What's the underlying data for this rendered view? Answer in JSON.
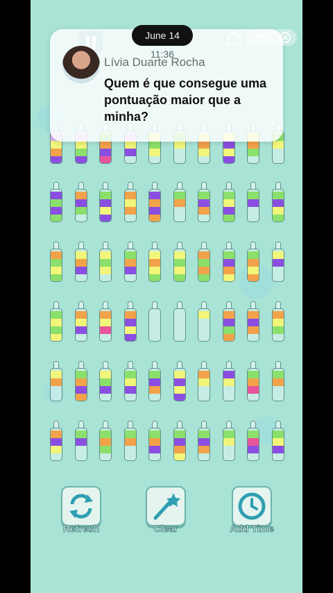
{
  "status": {
    "date": "June 14",
    "time": "11:36"
  },
  "notification": {
    "sender": "Lívia Duarte Rocha",
    "message": "Quem é que consegue uma pontuação maior que a minha?"
  },
  "tools": [
    {
      "label": "Refresh",
      "icon": "refresh-arrows-icon"
    },
    {
      "label": "Clear",
      "icon": "magic-wand-icon"
    },
    {
      "label": "Add Time",
      "icon": "clock-icon"
    }
  ],
  "colors": {
    "purple": "#8a4fe0",
    "green": "#8be06b",
    "orange": "#f2a24a",
    "yellow": "#f1f57a",
    "pink": "#e8559c",
    "lavender": "#d8b6f0",
    "background": "#a8e3d6"
  },
  "bottles": [
    [
      "lavender",
      "yellow",
      "orange",
      "purple"
    ],
    [
      "lavender",
      "yellow",
      "green",
      "purple"
    ],
    [
      "green",
      "orange",
      "purple",
      "pink"
    ],
    [
      "lavender",
      "yellow",
      "purple"
    ],
    [
      "yellow",
      "green",
      "yellow"
    ],
    [
      "green",
      "yellow"
    ],
    [
      "yellow",
      "orange",
      "yellow"
    ],
    [
      "yellow",
      "purple",
      "yellow",
      "purple"
    ],
    [
      "yellow",
      "orange",
      "green"
    ],
    [
      "green",
      "yellow"
    ],
    [
      "purple",
      "green",
      "purple",
      "green"
    ],
    [
      "orange",
      "purple",
      "green"
    ],
    [
      "green",
      "purple",
      "yellow",
      "purple"
    ],
    [
      "orange",
      "yellow",
      "orange"
    ],
    [
      "purple",
      "orange",
      "purple",
      "orange"
    ],
    [
      "green",
      "orange"
    ],
    [
      "green",
      "purple",
      "orange"
    ],
    [
      "green",
      "yellow",
      "purple",
      "green"
    ],
    [
      "green",
      "purple"
    ],
    [
      "green",
      "purple",
      "yellow",
      "green"
    ],
    [
      "orange",
      "green",
      "yellow",
      "green"
    ],
    [
      "yellow",
      "orange",
      "purple"
    ],
    [
      "yellow",
      "green",
      "yellow"
    ],
    [
      "green",
      "orange",
      "purple"
    ],
    [
      "yellow",
      "orange",
      "yellow",
      "green"
    ],
    [
      "yellow",
      "green",
      "yellow",
      "green"
    ],
    [
      "orange",
      "green",
      "orange",
      "green"
    ],
    [
      "green",
      "purple",
      "orange",
      "yellow"
    ],
    [
      "green",
      "orange",
      "yellow",
      "orange"
    ],
    [
      "empty",
      "yellow",
      "purple"
    ],
    [
      "green",
      "yellow",
      "green",
      "yellow"
    ],
    [
      "orange",
      "yellow",
      "purple"
    ],
    [
      "orange",
      "yellow",
      "pink"
    ],
    [
      "orange",
      "purple",
      "yellow",
      "purple"
    ],
    [
      "empty"
    ],
    [
      "empty"
    ],
    [
      "yellow"
    ],
    [
      "orange",
      "purple",
      "green",
      "orange"
    ],
    [
      "orange",
      "purple",
      "orange"
    ],
    [
      "orange",
      "yellow",
      "green"
    ],
    [
      "yellow",
      "orange"
    ],
    [
      "green",
      "orange",
      "purple",
      "orange"
    ],
    [
      "yellow",
      "green",
      "purple"
    ],
    [
      "green",
      "yellow",
      "purple"
    ],
    [
      "green",
      "purple",
      "orange"
    ],
    [
      "yellow",
      "purple",
      "yellow",
      "purple"
    ],
    [
      "orange",
      "yellow"
    ],
    [
      "purple",
      "yellow"
    ],
    [
      "green",
      "orange",
      "pink"
    ],
    [
      "green",
      "orange"
    ],
    [
      "orange",
      "purple",
      "yellow"
    ],
    [
      "green",
      "purple"
    ],
    [
      "green",
      "orange",
      "green"
    ],
    [
      "green",
      "orange"
    ],
    [
      "green",
      "orange",
      "purple"
    ],
    [
      "green",
      "purple",
      "orange",
      "yellow"
    ],
    [
      "green",
      "purple",
      "orange"
    ],
    [
      "green",
      "yellow"
    ],
    [
      "green",
      "pink",
      "purple"
    ],
    [
      "green",
      "yellow",
      "purple"
    ]
  ]
}
